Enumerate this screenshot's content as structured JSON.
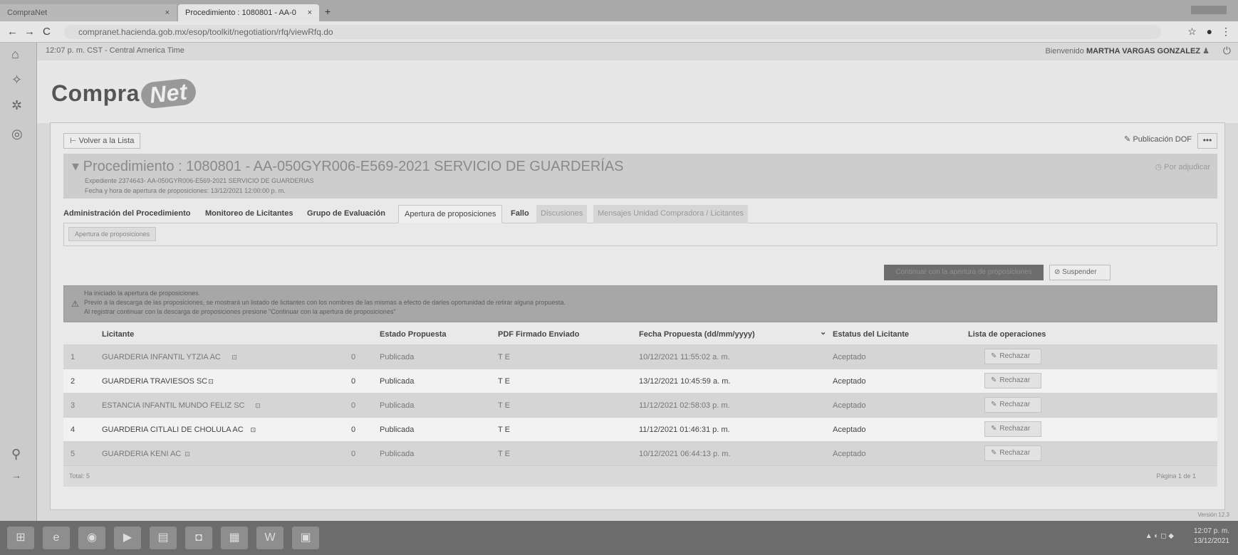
{
  "browser": {
    "tabs": [
      {
        "label": "CompraNet"
      },
      {
        "label": "Procedimiento : 1080801 - AA-0"
      }
    ],
    "close_glyph": "×",
    "new_tab_glyph": "+",
    "url": "compranet.hacienda.gob.mx/esop/toolkit/negotiation/rfq/viewRfq.do",
    "back_glyph": "←",
    "forward_glyph": "→",
    "reload_glyph": "C",
    "star_glyph": "☆",
    "profile_glyph": "●",
    "menu_glyph": "⋮"
  },
  "rail": {
    "icons": [
      "home-icon",
      "handshake-icon",
      "gear-icon",
      "globe-icon",
      "search-icon",
      "arrow-right-icon"
    ],
    "glyphs": {
      "home": "⌂",
      "handshake": "✧",
      "gear": "✲",
      "globe": "◎",
      "search": "⚲",
      "arrow": "→"
    }
  },
  "header": {
    "time_info": "12:07 p. m. CST - Central America Time",
    "welcome_prefix": "Bienvenido",
    "user_name": "MARTHA VARGAS GONZALEZ",
    "user_glyph": "♟",
    "power_glyph": "⏻"
  },
  "logo": {
    "part1": "Compra",
    "part2": "Net"
  },
  "toolbar": {
    "back_label": "Volver a la Lista",
    "back_glyph": "⊢",
    "pub_dof_label": "Publicación DOF",
    "pub_dof_glyph": "✎",
    "more_label": "•••"
  },
  "procedure": {
    "title": "Procedimiento : 1080801 - AA-050GYR006-E569-2021 SERVICIO DE GUARDERÍAS",
    "expediente": "Expediente 2374643- AA-050GYR006-E569-2021 SERVICIO DE GUARDERIAS",
    "fecha": "Fecha y hora de apertura de proposiciones: 13/12/2021 12:00:00 p. m.",
    "status": "Por adjudicar",
    "status_glyph": "◷",
    "chevron": "▾"
  },
  "tabs": [
    {
      "label": "Administración del Procedimiento"
    },
    {
      "label": "Monitoreo de Licitantes"
    },
    {
      "label": "Grupo de Evaluación"
    },
    {
      "label": "Apertura de proposiciones"
    },
    {
      "label": "Fallo"
    },
    {
      "label": "Discusiones"
    },
    {
      "label": "Mensajes Unidad Compradora / Licitantes"
    }
  ],
  "subtab": {
    "label": "Apertura de proposiciones"
  },
  "actions": {
    "continue_label": "Continuar con la apertura de proposiciones",
    "suspend_label": "Suspender",
    "suspend_glyph": "⊘"
  },
  "alert": {
    "glyph": "⚠",
    "line1": "Ha iniciado la apertura de proposiciones.",
    "line2": "Previo a la descarga de las proposiciones, se mostrará un listado de licitantes con los nombres de las mismas a efecto de darles oportunidad de retirar alguna propuesta.",
    "line3": "Al registrar continuar con la descarga de proposiciones presione \"Continuar con la apertura de proposiciones\""
  },
  "table": {
    "headers": {
      "licitante": "Licitante",
      "estado": "Estado Propuesta",
      "pdf": "PDF Firmado Enviado",
      "fecha": "Fecha Propuesta (dd/mm/yyyy)",
      "estatus": "Estatus del Licitante",
      "ops": "Lista de operaciones"
    },
    "sort_glyph": "⌄",
    "link_glyph": "⊡",
    "rows": [
      {
        "num": "1",
        "name": "GUARDERIA INFANTIL YTZIA AC",
        "count": "0",
        "estado": "Publicada",
        "pdf": "T E",
        "fecha": "10/12/2021 11:55:02 a. m.",
        "estatus": "Aceptado",
        "action": "Rechazar"
      },
      {
        "num": "2",
        "name": "GUARDERIA TRAVIESOS SC",
        "count": "0",
        "estado": "Publicada",
        "pdf": "T E",
        "fecha": "13/12/2021 10:45:59 a. m.",
        "estatus": "Aceptado",
        "action": "Rechazar"
      },
      {
        "num": "3",
        "name": "ESTANCIA INFANTIL MUNDO FELIZ SC",
        "count": "0",
        "estado": "Publicada",
        "pdf": "T E",
        "fecha": "11/12/2021 02:58:03 p. m.",
        "estatus": "Aceptado",
        "action": "Rechazar"
      },
      {
        "num": "4",
        "name": "GUARDERIA CITLALI DE CHOLULA AC",
        "count": "0",
        "estado": "Publicada",
        "pdf": "T E",
        "fecha": "11/12/2021 01:46:31 p. m.",
        "estatus": "Aceptado",
        "action": "Rechazar"
      },
      {
        "num": "5",
        "name": "GUARDERIA KENI AC",
        "count": "0",
        "estado": "Publicada",
        "pdf": "T E",
        "fecha": "10/12/2021 06:44:13 p. m.",
        "estatus": "Aceptado",
        "action": "Rechazar"
      }
    ],
    "reject_glyph": "✎",
    "total": "Total: 5",
    "pager": "Página 1 de 1"
  },
  "version": "Versión 12.3",
  "taskbar": {
    "icons": [
      "windows-start-icon",
      "internet-explorer-icon",
      "chrome-icon",
      "media-player-icon",
      "file-explorer-icon",
      "photos-icon",
      "folder-icon",
      "word-icon",
      "app-icon"
    ],
    "glyphs": [
      "⊞",
      "e",
      "◉",
      "▶",
      "▤",
      "◘",
      "▦",
      "W",
      "▣"
    ],
    "tray": "▲ ◐ ◻ ◆",
    "time": "12:07 p. m.",
    "date": "13/12/2021"
  },
  "colors": {
    "background": "#cfcfcf",
    "card": "#e9e9e9",
    "alert": "#a7a7a7",
    "dark_button": "#6d6d6d"
  }
}
